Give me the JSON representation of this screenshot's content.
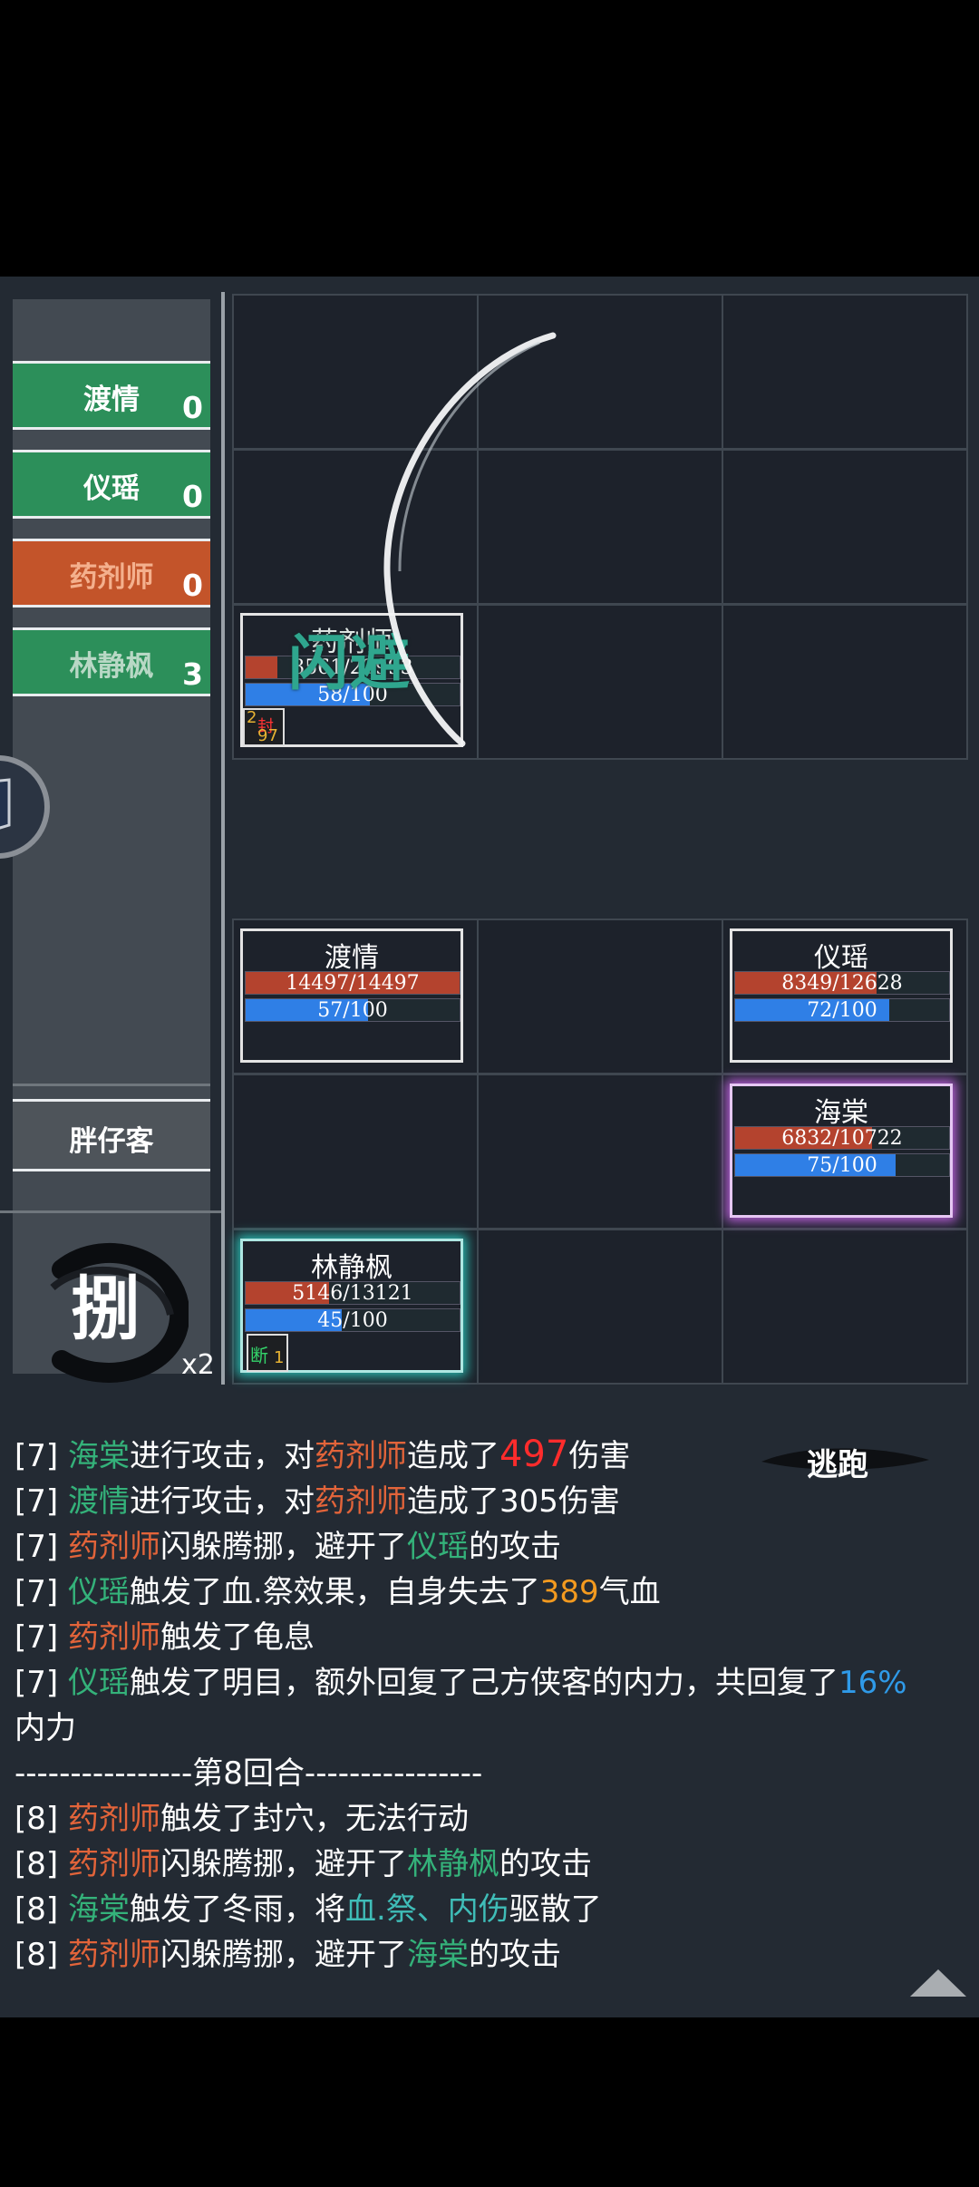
{
  "sidebar": {
    "items": [
      {
        "name": "渡情",
        "count": "0"
      },
      {
        "name": "仪瑶",
        "count": "0"
      },
      {
        "name": "药剂师",
        "count": "0"
      },
      {
        "name": "林静枫",
        "count": "3"
      }
    ],
    "reserve": "胖仔客",
    "skill_char": "捌",
    "skill_count": "x2"
  },
  "enemy": {
    "name": "药剂师",
    "hp": "3561/22993",
    "mp": "58/100",
    "floating_text": "闪避",
    "status_top": "2",
    "status_mid": "封",
    "status_bottom": "97"
  },
  "allies": [
    {
      "name": "渡情",
      "hp": "14497/14497",
      "hp_frac": 1.0,
      "mp": "57/100",
      "mp_frac": 0.57
    },
    {
      "name": "仪瑶",
      "hp": "8349/12628",
      "hp_frac": 0.66,
      "mp": "72/100",
      "mp_frac": 0.72
    },
    {
      "name": "海棠",
      "hp": "6832/10722",
      "hp_frac": 0.64,
      "mp": "75/100",
      "mp_frac": 0.75
    },
    {
      "name": "林静枫",
      "hp": "5146/13121",
      "hp_frac": 0.39,
      "mp": "45/100",
      "mp_frac": 0.45
    }
  ],
  "lin_status": {
    "char": "断",
    "count": "1"
  },
  "log": {
    "escape_button": "逃跑",
    "separator": "----------------第8回合----------------",
    "lines": [
      [
        "[7] ",
        "海棠",
        "进行攻击，对",
        "药剂师",
        "造成了",
        "497",
        "伤害"
      ],
      [
        "[7] ",
        "渡情",
        "进行攻击，对",
        "药剂师",
        "造成了305伤害"
      ],
      [
        "[7] ",
        "药剂师",
        "闪躲腾挪，避开了",
        "仪瑶",
        "的攻击"
      ],
      [
        "[7] ",
        "仪瑶",
        "触发了血.祭效果，自身失去了",
        "389",
        "气血"
      ],
      [
        "[7] ",
        "药剂师",
        "触发了龟息"
      ],
      [
        "[7] ",
        "仪瑶",
        "触发了明目，额外回复了己方侠客的内力，共回复了",
        "16%"
      ],
      [
        "内力"
      ],
      [
        "[8] ",
        "药剂师",
        "触发了封穴，无法行动"
      ],
      [
        "[8] ",
        "药剂师",
        "闪躲腾挪，避开了",
        "林静枫",
        "的攻击"
      ],
      [
        "[8] ",
        "海棠",
        "触发了冬雨，将",
        "血.祭、内伤",
        "驱散了"
      ],
      [
        "[8] ",
        "药剂师",
        "闪躲腾挪，避开了",
        "海棠",
        "的攻击"
      ]
    ]
  },
  "colors": {
    "green": "#34b27a",
    "orange": "#e2643a",
    "red": "#ff2c2c",
    "blue": "#2f9ae8"
  }
}
